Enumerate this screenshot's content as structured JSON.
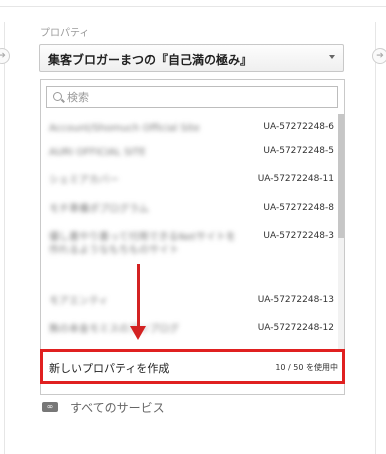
{
  "property_label": "プロパティ",
  "selected_property": "集客ブロガーまつの『自己満の極み』",
  "search": {
    "placeholder": "検索"
  },
  "rows": [
    {
      "name": "Account/Shomuch Official Site",
      "id": "UA-57272248-6"
    },
    {
      "name": "AURI OFFICIAL SITE",
      "id": "UA-57272248-5"
    },
    {
      "name": "シェミアカバー",
      "id": "UA-57272248-11"
    },
    {
      "name": "モチ準備ポプログラム",
      "id": "UA-57272248-8"
    },
    {
      "name": "優し書やり書って付用できるNetサイトを作れるようなもちものサイト",
      "id": "UA-57272248-3"
    },
    {
      "name": "モアエンティ",
      "id": "UA-57272248-13"
    },
    {
      "name": "無の本金モミスのアップログ",
      "id": "UA-57272248-12"
    }
  ],
  "create_property_label": "新しいプロパティを作成",
  "usage_text": "10 / 50 を使用中",
  "all_services_label": "すべてのサービス",
  "icons": {
    "search": "search-icon",
    "caret": "caret-down-icon",
    "link": "link-icon",
    "arrow": "red-arrow-annotation"
  },
  "colors": {
    "highlight": "#e02020",
    "arrow": "#d32222"
  }
}
